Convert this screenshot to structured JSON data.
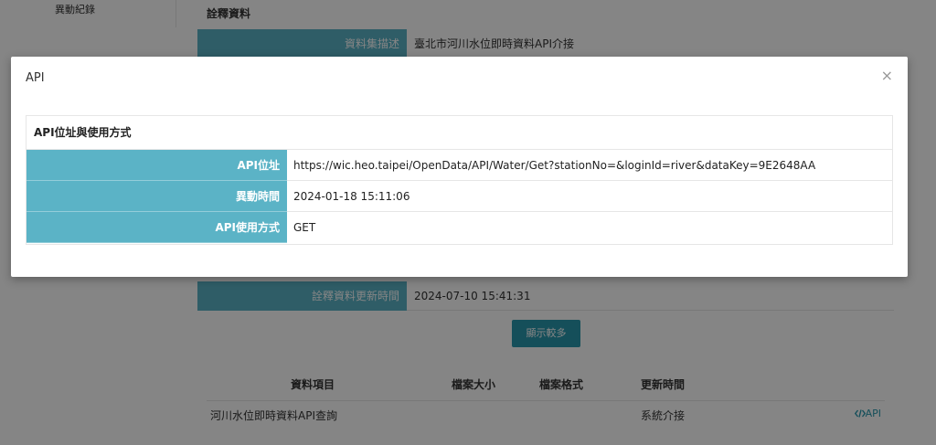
{
  "background": {
    "sidebar_item": "異動紀錄",
    "section_title": "詮釋資料",
    "rows": [
      {
        "label": "資料集描述",
        "value": "臺北市河川水位即時資料API介接"
      },
      {
        "label": "詮釋資料更新時間",
        "value": "2024-07-10 15:41:31"
      }
    ],
    "show_more_label": "顯示較多",
    "table": {
      "headers": [
        "資料項目",
        "檔案大小",
        "檔案格式",
        "更新時間"
      ],
      "row": {
        "item": "河川水位即時資料API查詢",
        "updated": "系統介接",
        "api_link": "API"
      }
    }
  },
  "modal": {
    "title": "API",
    "close_glyph": "×",
    "panel_heading": "API位址與使用方式",
    "rows": [
      {
        "label": "API位址",
        "value": "https://wic.heo.taipei/OpenData/API/Water/Get?stationNo=&loginId=river&dataKey=9E2648AA"
      },
      {
        "label": "異動時間",
        "value": "2024-01-18 15:11:06"
      },
      {
        "label": "API使用方式",
        "value": "GET"
      }
    ]
  },
  "colors": {
    "label_bg": "#5bb3c6",
    "button_bg": "#2a98ad",
    "overlay": "rgba(0,0,0,0.48)"
  },
  "icons": {
    "close": "close-icon",
    "api_code": "code-icon"
  }
}
